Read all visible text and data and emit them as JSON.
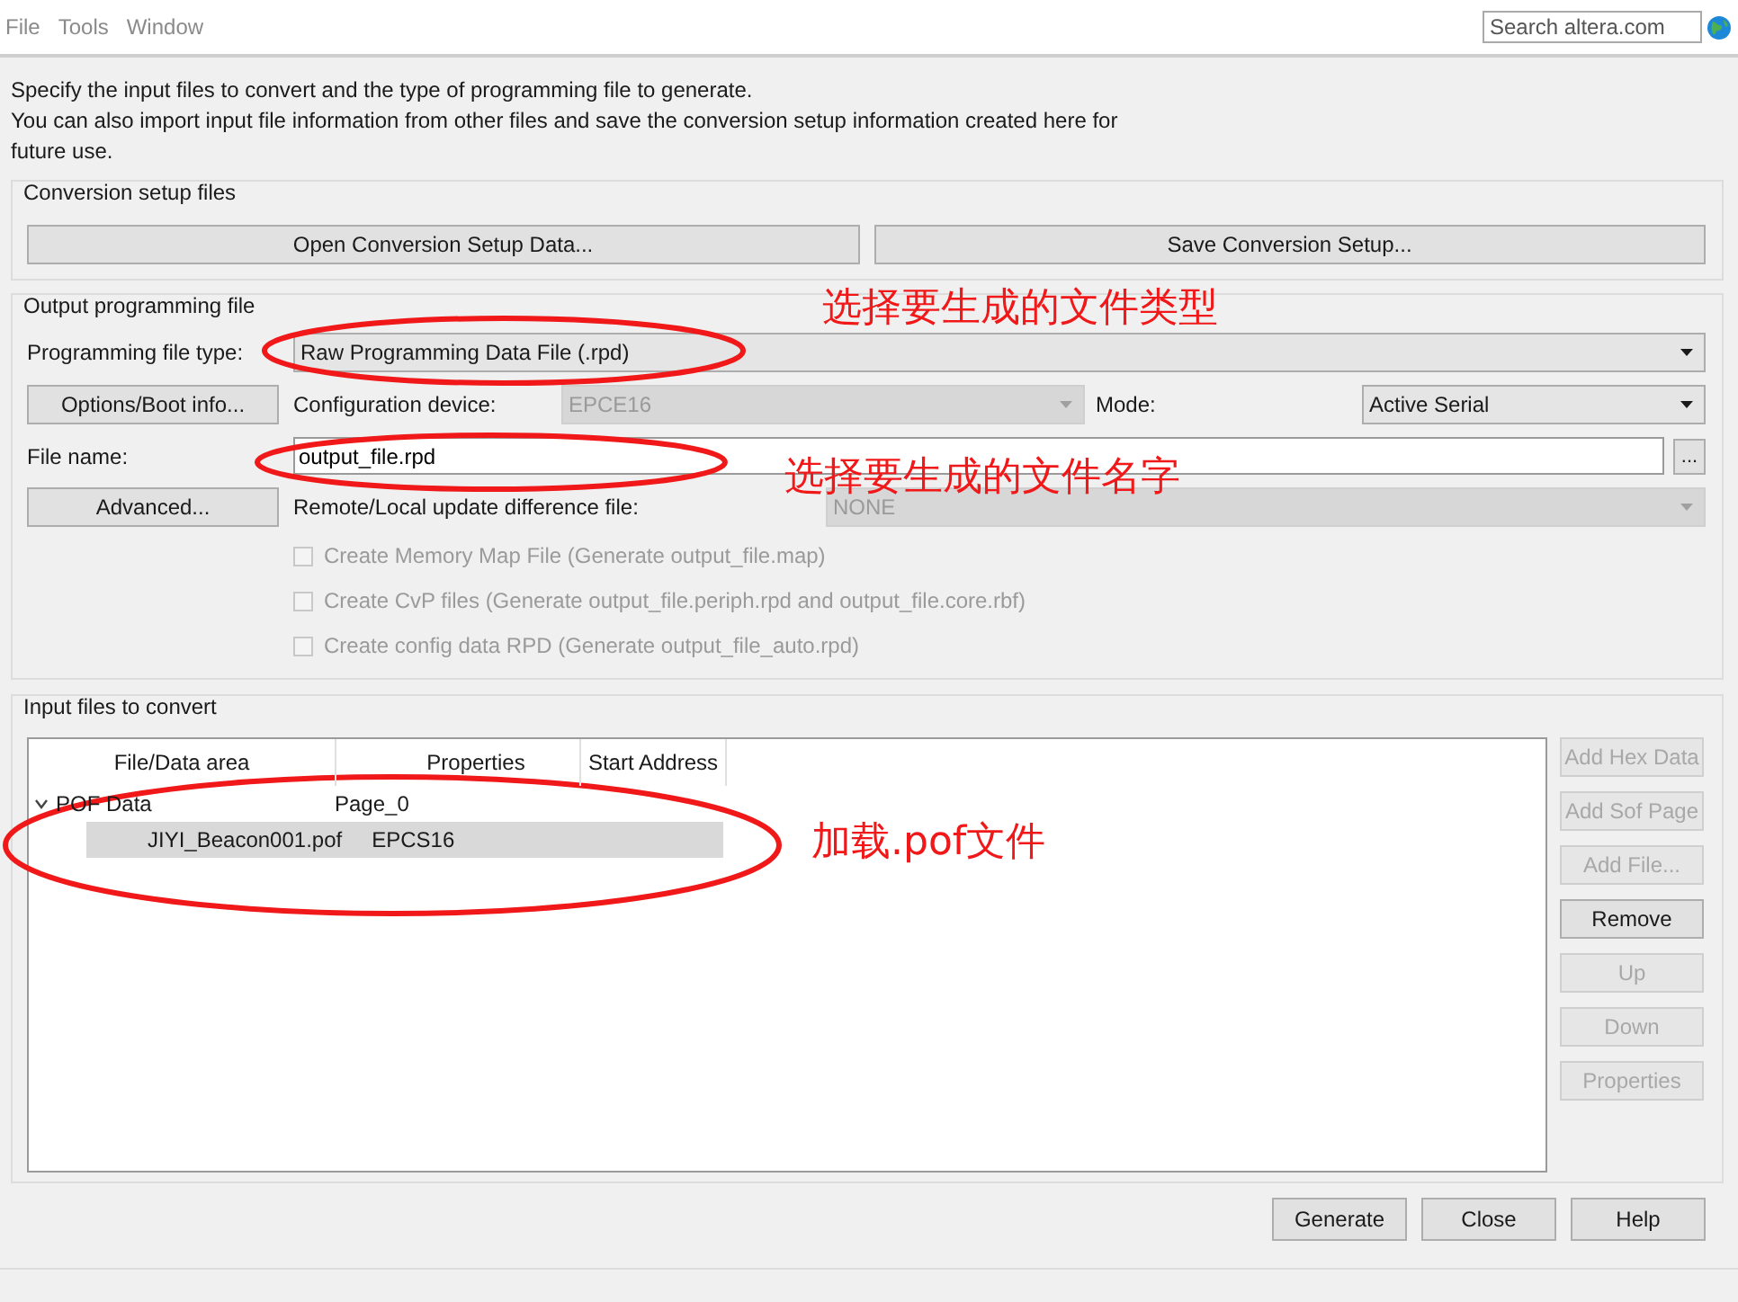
{
  "menu": [
    {
      "label": "File"
    },
    {
      "label": "Tools"
    },
    {
      "label": "Window"
    }
  ],
  "search": {
    "placeholder": "Search altera.com"
  },
  "intro": [
    "Specify the input files to convert and the type of programming file to generate.",
    "You can also import input file information from other files and save the conversion setup information created here for future use."
  ],
  "setup_group": {
    "title": "Conversion setup files",
    "buttons": [
      "Open Conversion Setup Data...",
      "Save Conversion Setup..."
    ]
  },
  "output_group": {
    "title": "Output programming file",
    "file_type": {
      "label": "Programming file type:",
      "value": "Raw Programming Data File (.rpd)",
      "disabled": false
    },
    "options_button": "Options/Boot info...",
    "device": {
      "label": "Configuration device:",
      "value": "EPCE16",
      "disabled": true
    },
    "mode": {
      "label": "Mode:",
      "value": "Active Serial",
      "disabled": false
    },
    "file_name": {
      "label": "File name:",
      "value": "output_file.rpd",
      "browse": "..."
    },
    "advanced_button": "Advanced...",
    "update_file": {
      "label": "Remote/Local update difference file:",
      "value": "NONE",
      "disabled": true
    },
    "checkboxes": [
      {
        "label": "Create Memory Map File (Generate output_file.map)",
        "checked": false,
        "disabled": true
      },
      {
        "label": "Create CvP files (Generate output_file.periph.rpd and output_file.core.rbf)",
        "checked": false,
        "disabled": true
      },
      {
        "label": "Create config data RPD (Generate output_file_auto.rpd)",
        "checked": false,
        "disabled": true
      }
    ]
  },
  "input_group": {
    "title": "Input files to convert",
    "columns": [
      "File/Data area",
      "Properties",
      "Start Address"
    ],
    "tree": [
      {
        "name": "POF Data",
        "properties": "Page_0",
        "expanded": true,
        "selected": false,
        "children": [
          {
            "name": "JIYI_Beacon001.pof",
            "properties": "EPCS16",
            "selected": true
          }
        ]
      }
    ],
    "buttons": [
      {
        "label": "Add Hex Data",
        "disabled": true
      },
      {
        "label": "Add Sof Page",
        "disabled": true
      },
      {
        "label": "Add File...",
        "disabled": true
      },
      {
        "label": "Remove",
        "disabled": false
      },
      {
        "label": "Up",
        "disabled": true
      },
      {
        "label": "Down",
        "disabled": true
      },
      {
        "label": "Properties",
        "disabled": true
      }
    ]
  },
  "footer_buttons": [
    "Generate",
    "Close",
    "Help"
  ],
  "annotations": [
    {
      "text": "选择要生成的文件类型"
    },
    {
      "text": "选择要生成的文件名字"
    },
    {
      "text": "加载.pof文件"
    }
  ]
}
